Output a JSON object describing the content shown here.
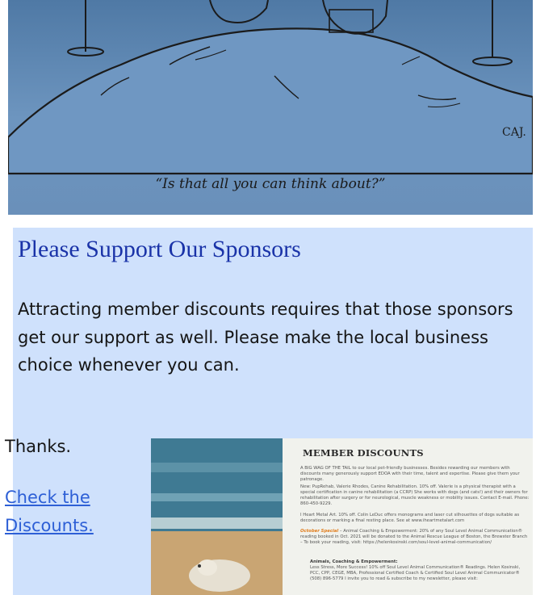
{
  "cartoon": {
    "caption": "“Is that all you can think about?”",
    "signature": "CAJ."
  },
  "sponsors": {
    "title": "Please Support Our Sponsors",
    "body": "Attracting member discounts requires that those sponsors get our support as well.  Please make the local business choice whenever you can.",
    "thanks": "Thanks.",
    "link_line1": "Check the",
    "link_line2": "Discounts."
  },
  "discount_image": {
    "title": "MEMBER DISCOUNTS",
    "intro": "A BIG WAG OF THE TAIL to our local pet-friendly businesses. Besides rewarding our members with discounts many generously support EDOA with their time, talent and expertise. Please give them your patronage.",
    "item1": "New: PupRehab, Valerie Rhodes, Canine Rehabilitation. 10% off. Valerie is a physical therapist with a special certification in canine rehabilitation (a CCRP) She works with dogs (and cats!) and their owners for rehabilitation after surgery or for neurological, muscle weakness or mobility issues. Contact E-mail. Phone: 860-450-9229.",
    "item2": "I Heart Metal Art. 10% off. Colin LeDuc offers monograms and laser cut silhouettes of dogs suitable as decorations or marking a final resting place. See at www.iheartmetalart.com",
    "special_label": "October Special",
    "item3": "– Animal Coaching & Empowerment: 20% of any Soul Level Animal Communication® reading booked in Oct. 2021 will be donated to the Animal Rescue League of Boston, the Brewster Branch – To book your reading, visit: https://helenkosinski.com/soul-level-animal-communication/",
    "item4_title": "Animals, Coaching & Empowerment:",
    "item4": "Less Stress, More Success! 10% off Soul Level Animal Communication® Readings. Helen Kosinski, PCC, CPP, CEGE, MBA, Professional Certified Coach & Certified Soul Level Animal Communicator® (508) 896-5779 I invite you to read & subscribe to my newsletter, please visit:"
  }
}
